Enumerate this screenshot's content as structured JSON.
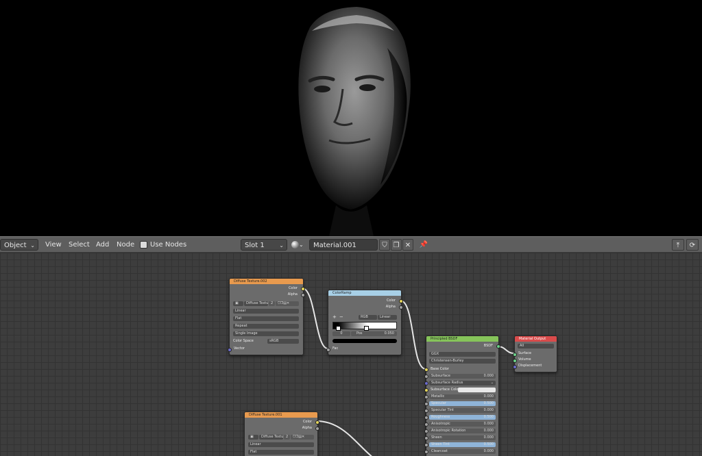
{
  "header": {
    "mode": "Object",
    "menus": [
      "View",
      "Select",
      "Add",
      "Node"
    ],
    "use_nodes_label": "Use Nodes",
    "slot": "Slot 1",
    "material_name": "Material.001"
  },
  "nodes": {
    "tex1": {
      "title": "Diffuse Texture.002",
      "outputs": [
        "Color",
        "Alpha"
      ],
      "image": "Diffuse Textur...",
      "users": "2",
      "interpolation": "Linear",
      "projection": "Flat",
      "extension": "Repeat",
      "source": "Single Image",
      "colorspace_label": "Color Space",
      "colorspace": "sRGB",
      "input": "Vector"
    },
    "tex2": {
      "title": "Diffuse Texture.001",
      "outputs": [
        "Color",
        "Alpha"
      ],
      "image": "Diffuse Textur...",
      "users": "2",
      "interpolation": "Linear",
      "projection": "Flat"
    },
    "ramp": {
      "title": "ColorRamp",
      "outputs": [
        "Color",
        "Alpha"
      ],
      "color_mode": "RGB",
      "interp": "Linear",
      "index": "0",
      "pos_label": "Pos",
      "pos_value": "0.050",
      "input": "Fac"
    },
    "bsdf": {
      "title": "Principled BSDF",
      "output": "BSDF",
      "distribution": "GGX",
      "subsurface_method": "Christensen-Burley",
      "rows": [
        {
          "label": "Base Color",
          "kind": "socket"
        },
        {
          "label": "Subsurface",
          "value": "0.000",
          "kind": "num"
        },
        {
          "label": "Subsurface Radius",
          "kind": "dropdown"
        },
        {
          "label": "Subsurface Color",
          "kind": "color"
        },
        {
          "label": "Metallic",
          "value": "0.000",
          "kind": "num"
        },
        {
          "label": "Specular",
          "value": "0.500",
          "kind": "blue"
        },
        {
          "label": "Specular Tint",
          "value": "0.000",
          "kind": "num"
        },
        {
          "label": "Roughness",
          "value": "0.500",
          "kind": "blue"
        },
        {
          "label": "Anisotropic",
          "value": "0.000",
          "kind": "num"
        },
        {
          "label": "Anisotropic Rotation",
          "value": "0.000",
          "kind": "num"
        },
        {
          "label": "Sheen",
          "value": "0.000",
          "kind": "num"
        },
        {
          "label": "Sheen Tint",
          "value": "0.500",
          "kind": "blue"
        },
        {
          "label": "Clearcoat",
          "value": "0.000",
          "kind": "num"
        }
      ]
    },
    "output": {
      "title": "Material Output",
      "target": "All",
      "inputs": [
        "Surface",
        "Volume",
        "Displacement"
      ]
    }
  }
}
